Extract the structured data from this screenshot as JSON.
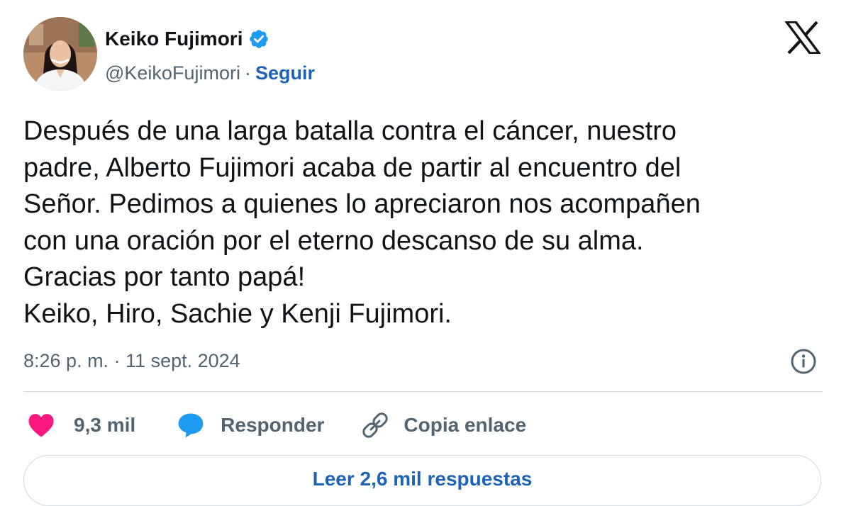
{
  "author": {
    "display_name": "Keiko Fujimori",
    "handle": "@KeikoFujimori",
    "separator": "·",
    "follow_label": "Seguir"
  },
  "tweet": {
    "lines": [
      "Después de una larga batalla contra el cáncer, nuestro",
      "padre, Alberto Fujimori acaba de partir al encuentro del",
      "Señor. Pedimos a quienes lo apreciaron nos acompañen",
      "con una oración por el eterno descanso de su alma.",
      "Gracias por tanto papá!",
      "Keiko, Hiro, Sachie y Kenji Fujimori."
    ],
    "timestamp": "8:26 p. m. · 11 sept. 2024"
  },
  "actions": {
    "like_count": "9,3 mil",
    "reply_label": "Responder",
    "copy_label": "Copia enlace"
  },
  "replies_button": "Leer 2,6 mil respuestas",
  "icons": {
    "logo": "x-logo-icon",
    "verified": "verified-badge-icon",
    "info": "info-icon",
    "like": "heart-icon",
    "reply": "speech-bubble-icon",
    "copy": "link-icon"
  },
  "colors": {
    "link": "#1d64b8",
    "verified": "#1d9bf0",
    "heart": "#f91880",
    "reply_icon": "#1d9bf0",
    "secondary_text": "#536471"
  }
}
